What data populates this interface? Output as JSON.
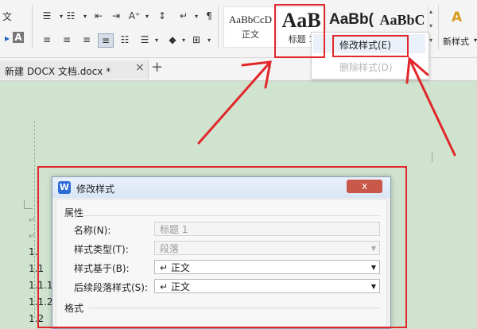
{
  "ribbon": {
    "styles": [
      {
        "sample": "AaBbCcD",
        "caption": "正文"
      },
      {
        "sample": "AaB",
        "caption": "标题 1"
      },
      {
        "sample": "AaBb(",
        "caption": ""
      },
      {
        "sample": "AaBbC",
        "caption": ""
      }
    ],
    "new_style_label": "新样式",
    "text_glyph": "文",
    "font_glyph": "A"
  },
  "context_menu": {
    "items": [
      {
        "label": "修改样式(E)",
        "enabled": true
      },
      {
        "label": "删除样式(D)",
        "enabled": false
      }
    ]
  },
  "tabbar": {
    "doc_tab_label": "新建 DOCX 文档.docx *",
    "add_tab_glyph": "+"
  },
  "document": {
    "lines": [
      "1.",
      "1.1",
      "1.1.1",
      "1.1.2",
      "1.2"
    ]
  },
  "dialog": {
    "title": "修改样式",
    "close_glyph": "x",
    "section_properties": "属性",
    "fields": [
      {
        "label": "名称(N):",
        "value": "标题 1",
        "disabled": true,
        "dropdown": false
      },
      {
        "label": "样式类型(T):",
        "value": "段落",
        "disabled": true,
        "dropdown": true
      },
      {
        "label": "样式基于(B):",
        "value": "↵ 正文",
        "disabled": false,
        "dropdown": true
      },
      {
        "label": "后续段落样式(S):",
        "value": "↵ 正文",
        "disabled": false,
        "dropdown": true
      }
    ],
    "section_format": "格式"
  },
  "colors": {
    "annotation_red": "#e1272b",
    "doc_background": "#cfe3cf",
    "app_logo_blue": "#2d6bd8"
  }
}
